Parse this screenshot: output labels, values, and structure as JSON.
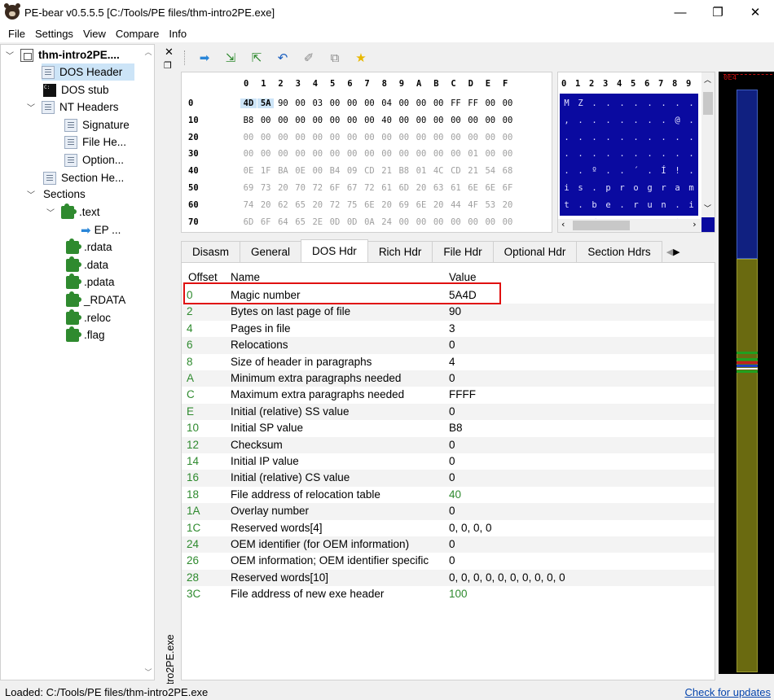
{
  "window": {
    "title": "PE-bear v0.5.5.5 [C:/Tools/PE files/thm-intro2PE.exe]",
    "minimize": "—",
    "maximize": "❐",
    "close": "✕"
  },
  "menu": [
    "File",
    "Settings",
    "View",
    "Compare",
    "Info"
  ],
  "tree": {
    "root": "thm-intro2PE....",
    "items": [
      {
        "label": "DOS Header",
        "icon": "document-icon"
      },
      {
        "label": "DOS stub",
        "icon": "console-icon"
      },
      {
        "label": "NT Headers",
        "icon": "document-icon"
      },
      {
        "label": "Signature",
        "icon": "document-icon"
      },
      {
        "label": "File He...",
        "icon": "document-icon"
      },
      {
        "label": "Option...",
        "icon": "document-icon"
      },
      {
        "label": "Section He...",
        "icon": "document-icon"
      },
      {
        "label": "Sections",
        "icon": ""
      },
      {
        "label": ".text",
        "icon": "puzzle-icon"
      },
      {
        "label": "EP ...",
        "icon": "arrow-icon"
      },
      {
        "label": ".rdata",
        "icon": "puzzle-icon"
      },
      {
        "label": ".data",
        "icon": "puzzle-icon"
      },
      {
        "label": ".pdata",
        "icon": "puzzle-icon"
      },
      {
        "label": "_RDATA",
        "icon": "puzzle-icon"
      },
      {
        "label": ".reloc",
        "icon": "puzzle-icon"
      },
      {
        "label": ".flag",
        "icon": "puzzle-icon"
      }
    ]
  },
  "side_label": "thm-intro2PE.exe",
  "hex": {
    "columns": [
      "0",
      "1",
      "2",
      "3",
      "4",
      "5",
      "6",
      "7",
      "8",
      "9",
      "A",
      "B",
      "C",
      "D",
      "E",
      "F"
    ],
    "rows": [
      {
        "addr": "0",
        "bytes": [
          "4D",
          "5A",
          "90",
          "00",
          "03",
          "00",
          "00",
          "00",
          "04",
          "00",
          "00",
          "00",
          "FF",
          "FF",
          "00",
          "00"
        ]
      },
      {
        "addr": "10",
        "bytes": [
          "B8",
          "00",
          "00",
          "00",
          "00",
          "00",
          "00",
          "00",
          "40",
          "00",
          "00",
          "00",
          "00",
          "00",
          "00",
          "00"
        ]
      },
      {
        "addr": "20",
        "bytes": [
          "00",
          "00",
          "00",
          "00",
          "00",
          "00",
          "00",
          "00",
          "00",
          "00",
          "00",
          "00",
          "00",
          "00",
          "00",
          "00"
        ]
      },
      {
        "addr": "30",
        "bytes": [
          "00",
          "00",
          "00",
          "00",
          "00",
          "00",
          "00",
          "00",
          "00",
          "00",
          "00",
          "00",
          "00",
          "01",
          "00",
          "00"
        ]
      },
      {
        "addr": "40",
        "bytes": [
          "0E",
          "1F",
          "BA",
          "0E",
          "00",
          "B4",
          "09",
          "CD",
          "21",
          "B8",
          "01",
          "4C",
          "CD",
          "21",
          "54",
          "68"
        ]
      },
      {
        "addr": "50",
        "bytes": [
          "69",
          "73",
          "20",
          "70",
          "72",
          "6F",
          "67",
          "72",
          "61",
          "6D",
          "20",
          "63",
          "61",
          "6E",
          "6E",
          "6F"
        ]
      },
      {
        "addr": "60",
        "bytes": [
          "74",
          "20",
          "62",
          "65",
          "20",
          "72",
          "75",
          "6E",
          "20",
          "69",
          "6E",
          "20",
          "44",
          "4F",
          "53",
          "20"
        ]
      },
      {
        "addr": "70",
        "bytes": [
          "6D",
          "6F",
          "64",
          "65",
          "2E",
          "0D",
          "0D",
          "0A",
          "24",
          "00",
          "00",
          "00",
          "00",
          "00",
          "00",
          "00"
        ]
      }
    ]
  },
  "ascii": {
    "columns": [
      "0",
      "1",
      "2",
      "3",
      "4",
      "5",
      "6",
      "7",
      "8",
      "9"
    ],
    "rows": [
      [
        "M",
        "Z",
        ".",
        ".",
        ".",
        ".",
        ".",
        ".",
        ".",
        "."
      ],
      [
        ",",
        ".",
        ".",
        ".",
        ".",
        ".",
        ".",
        ".",
        "@",
        "."
      ],
      [
        ".",
        ".",
        ".",
        ".",
        ".",
        ".",
        ".",
        ".",
        ".",
        "."
      ],
      [
        ".",
        ".",
        ".",
        ".",
        ".",
        ".",
        ".",
        ".",
        ".",
        "."
      ],
      [
        ".",
        ".",
        "º",
        ".",
        ".",
        "´",
        ".",
        "Í",
        "!",
        "."
      ],
      [
        "i",
        "s",
        ".",
        "p",
        "r",
        "o",
        "g",
        "r",
        "a",
        "m"
      ],
      [
        "t",
        ".",
        "b",
        "e",
        ".",
        "r",
        "u",
        "n",
        ".",
        "i"
      ],
      [
        "m",
        "o",
        "d",
        "e",
        ".",
        ".",
        ".",
        ".",
        "$",
        "."
      ]
    ]
  },
  "tabs": [
    "Disasm",
    "General",
    "DOS Hdr",
    "Rich Hdr",
    "File Hdr",
    "Optional Hdr",
    "Section Hdrs"
  ],
  "active_tab": "DOS Hdr",
  "table": {
    "headers": {
      "offset": "Offset",
      "name": "Name",
      "value": "Value"
    },
    "rows": [
      {
        "offset": "0",
        "name": "Magic number",
        "value": "5A4D"
      },
      {
        "offset": "2",
        "name": "Bytes on last page of file",
        "value": "90"
      },
      {
        "offset": "4",
        "name": "Pages in file",
        "value": "3"
      },
      {
        "offset": "6",
        "name": "Relocations",
        "value": "0"
      },
      {
        "offset": "8",
        "name": "Size of header in paragraphs",
        "value": "4"
      },
      {
        "offset": "A",
        "name": "Minimum extra paragraphs needed",
        "value": "0"
      },
      {
        "offset": "C",
        "name": "Maximum extra paragraphs needed",
        "value": "FFFF"
      },
      {
        "offset": "E",
        "name": "Initial (relative) SS value",
        "value": "0"
      },
      {
        "offset": "10",
        "name": "Initial SP value",
        "value": "B8"
      },
      {
        "offset": "12",
        "name": "Checksum",
        "value": "0"
      },
      {
        "offset": "14",
        "name": "Initial IP value",
        "value": "0"
      },
      {
        "offset": "16",
        "name": "Initial (relative) CS value",
        "value": "0"
      },
      {
        "offset": "18",
        "name": "File address of relocation table",
        "value": "40"
      },
      {
        "offset": "1A",
        "name": "Overlay number",
        "value": "0"
      },
      {
        "offset": "1C",
        "name": "Reserved words[4]",
        "value": "0, 0, 0, 0"
      },
      {
        "offset": "24",
        "name": "OEM identifier (for OEM information)",
        "value": "0"
      },
      {
        "offset": "26",
        "name": "OEM information; OEM identifier specific",
        "value": "0"
      },
      {
        "offset": "28",
        "name": "Reserved words[10]",
        "value": "0, 0, 0, 0, 0, 0, 0, 0, 0, 0"
      },
      {
        "offset": "3C",
        "name": "File address of new exe header",
        "value": "100"
      }
    ]
  },
  "overview_label": "0E4",
  "status": {
    "left": "Loaded: C:/Tools/PE files/thm-intro2PE.exe",
    "right": "Check for updates"
  },
  "colors": {
    "accent_red": "#e01010",
    "offset_green": "#2e8a2e",
    "ascii_navy": "#0a0aa0",
    "overview_blue": "#102080",
    "overview_olive": "#6a6a10"
  }
}
